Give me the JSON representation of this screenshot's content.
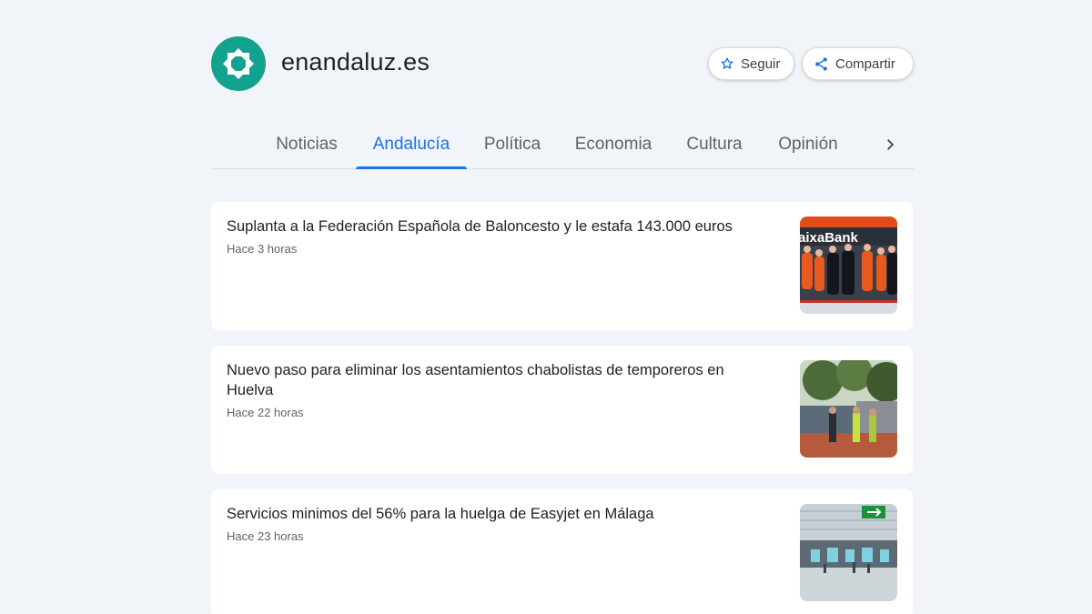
{
  "publisher": {
    "name": "enandaluz.es",
    "logo_icon": "eight-point-star-logo",
    "brand_color": "#12a38e"
  },
  "actions": {
    "follow_label": "Seguir",
    "follow_icon": "star-outline-icon",
    "share_label": "Compartir",
    "share_icon": "share-icon"
  },
  "tabs": [
    {
      "label": "Noticias",
      "active": false
    },
    {
      "label": "Andalucía",
      "active": true
    },
    {
      "label": "Política",
      "active": false
    },
    {
      "label": "Economia",
      "active": false
    },
    {
      "label": "Cultura",
      "active": false
    },
    {
      "label": "Opinión",
      "active": false
    }
  ],
  "tab_next_icon": "chevron-right-icon",
  "accent_color": "#1a73e8",
  "articles": [
    {
      "title": "Suplanta a la Federación Española de Baloncesto y le estafa 143.000 euros",
      "time": "Hace 3 horas",
      "thumb_text": "aixaBank"
    },
    {
      "title": "Nuevo paso para eliminar los asentamientos chabolistas de temporeros en Huelva",
      "time": "Hace 22 horas"
    },
    {
      "title": "Servicios minimos del 56% para la huelga de Easyjet en Málaga",
      "time": "Hace 23 horas"
    }
  ]
}
